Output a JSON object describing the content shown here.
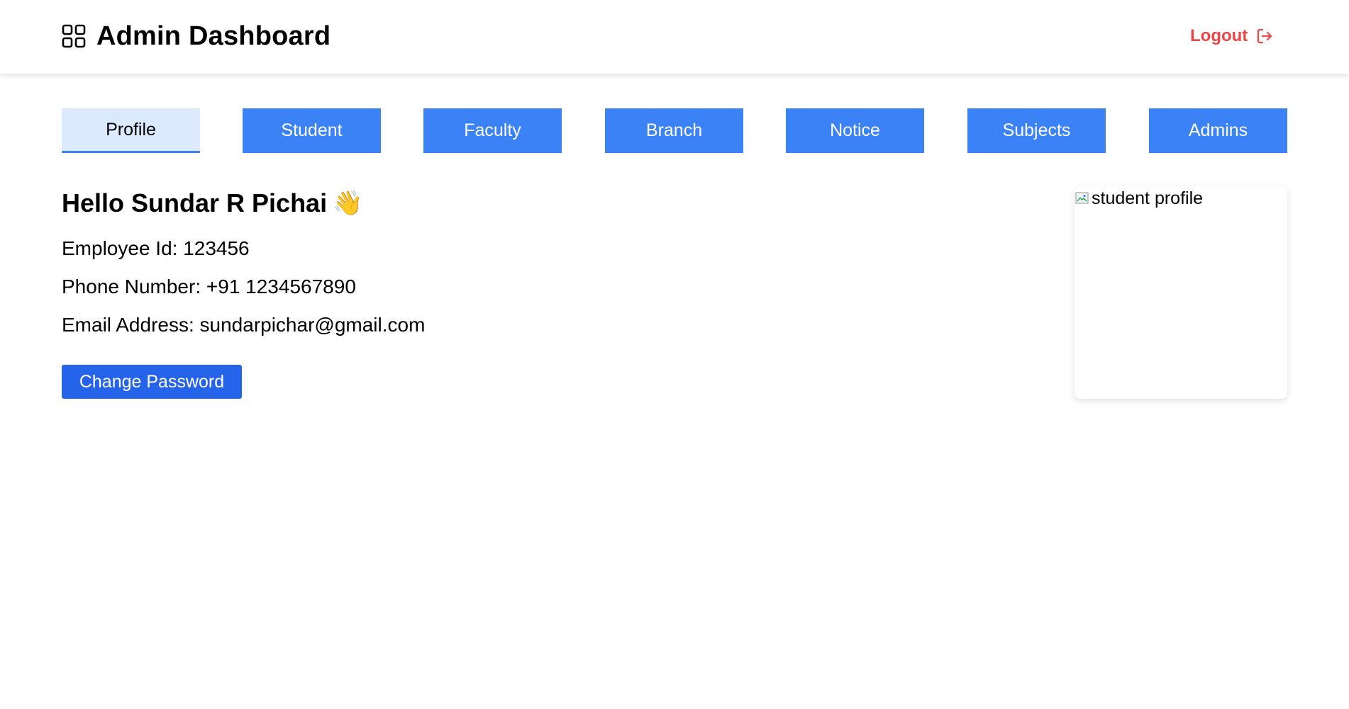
{
  "header": {
    "title": "Admin Dashboard",
    "brand_icon": "grid-icon",
    "logout_label": "Logout",
    "logout_icon": "logout-arrow-icon",
    "logout_color": "#ef4444"
  },
  "tabs": [
    {
      "label": "Profile",
      "active": true
    },
    {
      "label": "Student",
      "active": false
    },
    {
      "label": "Faculty",
      "active": false
    },
    {
      "label": "Branch",
      "active": false
    },
    {
      "label": "Notice",
      "active": false
    },
    {
      "label": "Subjects",
      "active": false
    },
    {
      "label": "Admins",
      "active": false
    }
  ],
  "colors": {
    "tab_bg": "#3b82f6",
    "tab_active_bg": "#dbeafe",
    "primary_button": "#2563eb"
  },
  "profile": {
    "greeting": "Hello Sundar R Pichai",
    "wave_emoji": "👋",
    "employee_id": "Employee Id: 123456",
    "phone": "Phone Number: +91 1234567890",
    "email": "Email Address: sundarpichar@gmail.com",
    "change_password_label": "Change Password",
    "image_alt": "student profile"
  }
}
